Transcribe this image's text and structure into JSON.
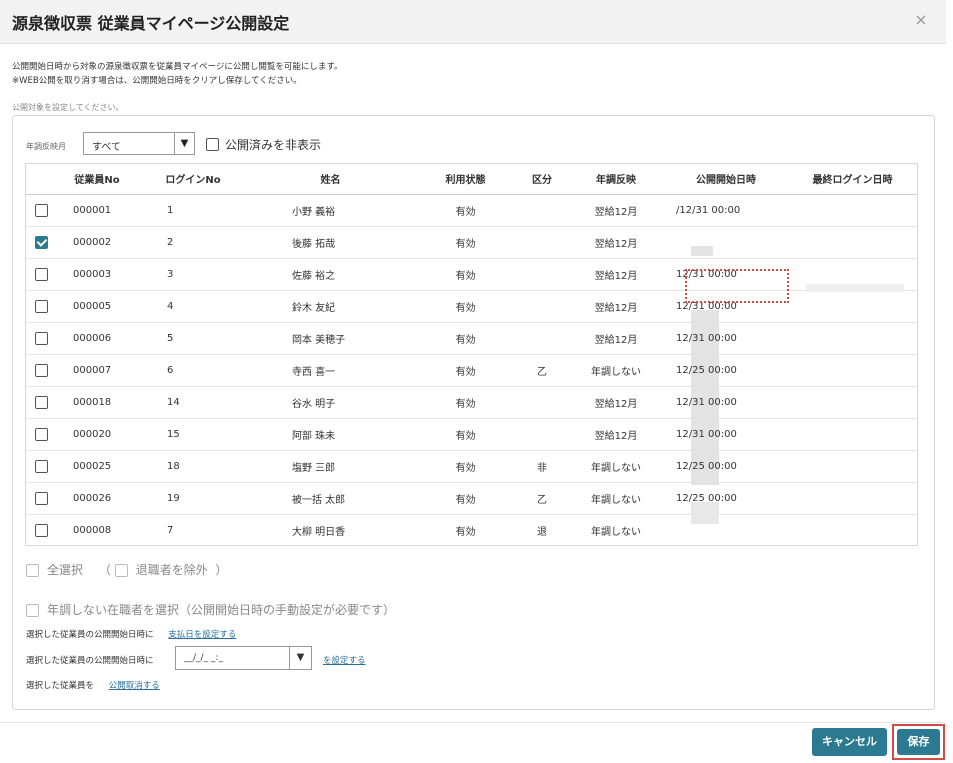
{
  "header": {
    "title": "源泉徴収票 従業員マイページ公開設定",
    "close_icon": "×"
  },
  "description": {
    "line1": "公開開始日時から対象の源泉徴収票を従業員マイページに公開し閲覧を可能にします。",
    "line2": "※WEB公開を取り消す場合は、公開開始日時をクリアし保存してください。"
  },
  "target_label": "公開対象を設定してください。",
  "filter": {
    "label": "年調反映月",
    "select_value": "すべて",
    "arrow": "▼",
    "hide_public_label": "公開済みを非表示"
  },
  "table": {
    "headers": [
      "",
      "従業員No",
      "ログインNo",
      "姓名",
      "利用状態",
      "区分",
      "年調反映",
      "公開開始日時",
      "最終ログイン日時"
    ],
    "rows": [
      {
        "checked": false,
        "emp": "000001",
        "login": "1",
        "name": "小野 義裕",
        "status": "有効",
        "kubun": "",
        "nencho": "翌給12月",
        "start": "/12/31 00:00",
        "last": ""
      },
      {
        "checked": true,
        "emp": "000002",
        "login": "2",
        "name": "後藤 拓哉",
        "status": "有効",
        "kubun": "",
        "nencho": "翌給12月",
        "start": "",
        "last": ""
      },
      {
        "checked": false,
        "emp": "000003",
        "login": "3",
        "name": "佐藤 裕之",
        "status": "有効",
        "kubun": "",
        "nencho": "翌給12月",
        "start": "12/31 00:00",
        "last": ""
      },
      {
        "checked": false,
        "emp": "000005",
        "login": "4",
        "name": "鈴木 友紀",
        "status": "有効",
        "kubun": "",
        "nencho": "翌給12月",
        "start": "12/31 00:00",
        "last": ""
      },
      {
        "checked": false,
        "emp": "000006",
        "login": "5",
        "name": "岡本 美穂子",
        "status": "有効",
        "kubun": "",
        "nencho": "翌給12月",
        "start": "12/31 00:00",
        "last": ""
      },
      {
        "checked": false,
        "emp": "000007",
        "login": "6",
        "name": "寺西 喜一",
        "status": "有効",
        "kubun": "乙",
        "nencho": "年調しない",
        "start": "12/25 00:00",
        "last": ""
      },
      {
        "checked": false,
        "emp": "000018",
        "login": "14",
        "name": "谷水 明子",
        "status": "有効",
        "kubun": "",
        "nencho": "翌給12月",
        "start": "12/31 00:00",
        "last": ""
      },
      {
        "checked": false,
        "emp": "000020",
        "login": "15",
        "name": "阿部 珠未",
        "status": "有効",
        "kubun": "",
        "nencho": "翌給12月",
        "start": "12/31 00:00",
        "last": ""
      },
      {
        "checked": false,
        "emp": "000025",
        "login": "18",
        "name": "塩野 三郎",
        "status": "有効",
        "kubun": "非",
        "nencho": "年調しない",
        "start": "12/25 00:00",
        "last": ""
      },
      {
        "checked": false,
        "emp": "000026",
        "login": "19",
        "name": "被一括 太郎",
        "status": "有効",
        "kubun": "乙",
        "nencho": "年調しない",
        "start": "12/25 00:00",
        "last": ""
      },
      {
        "checked": false,
        "emp": "000008",
        "login": "7",
        "name": "大柳 明日香",
        "status": "有効",
        "kubun": "退",
        "nencho": "年調しない",
        "start": "",
        "last": ""
      }
    ]
  },
  "options": {
    "select_all": "全選択",
    "paren_open": "（",
    "exclude_retired": "退職者を除外",
    "paren_close": "）",
    "select_non_nencho": "年調しない在職者を選択（公開開始日時の手動設定が必要です）"
  },
  "actions": {
    "row1_text": "選択した従業員の公開開始日時に",
    "row1_link": "支払日を設定する",
    "row2_text": "選択した従業員の公開開始日時に",
    "row2_placeholder": "__/_/_ _:_",
    "row2_arrow": "▼",
    "row2_link": "を設定する",
    "row3_text": "選択した従業員を",
    "row3_link": "公開取消する"
  },
  "footer": {
    "cancel": "キャンセル",
    "save": "保存"
  },
  "colors": {
    "accent": "#2b7a91",
    "highlight": "#d24a4a"
  }
}
